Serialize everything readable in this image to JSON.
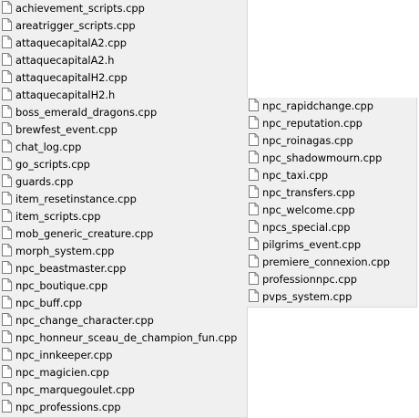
{
  "file_icon": "file-icon",
  "left_files": [
    "achievement_scripts.cpp",
    "areatrigger_scripts.cpp",
    "attaquecapitalA2.cpp",
    "attaquecapitalA2.h",
    "attaquecapitalH2.cpp",
    "attaquecapitalH2.h",
    "boss_emerald_dragons.cpp",
    "brewfest_event.cpp",
    "chat_log.cpp",
    "go_scripts.cpp",
    "guards.cpp",
    "item_resetinstance.cpp",
    "item_scripts.cpp",
    "mob_generic_creature.cpp",
    "morph_system.cpp",
    "npc_beastmaster.cpp",
    "npc_boutique.cpp",
    "npc_buff.cpp",
    "npc_change_character.cpp",
    "npc_honneur_sceau_de_champion_fun.cpp",
    "npc_innkeeper.cpp",
    "npc_magicien.cpp",
    "npc_marquegoulet.cpp",
    "npc_professions.cpp"
  ],
  "right_files": [
    "npc_rapidchange.cpp",
    "npc_reputation.cpp",
    "npc_roinagas.cpp",
    "npc_shadowmourn.cpp",
    "npc_taxi.cpp",
    "npc_transfers.cpp",
    "npc_welcome.cpp",
    "npcs_special.cpp",
    "pilgrims_event.cpp",
    "premiere_connexion.cpp",
    "professionnpc.cpp",
    "pvps_system.cpp"
  ]
}
